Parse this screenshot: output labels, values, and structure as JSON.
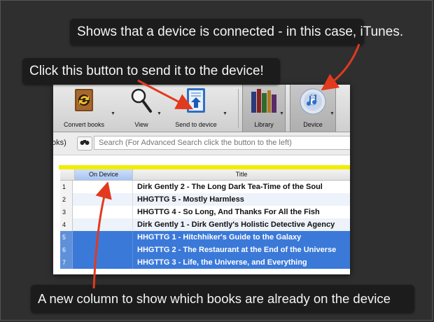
{
  "callouts": {
    "itunes": "Shows that a device is connected - in this case, iTunes.",
    "send": "Click this button to send it to the device!",
    "column": "A new column to show which books are already on the device"
  },
  "toolbar": {
    "convert_label": "Convert books",
    "view_label": "View",
    "send_label": "Send to device",
    "library_label": "Library",
    "device_label": "Device"
  },
  "search": {
    "left_text": "oks)",
    "binoculars_icon": "binoculars-icon",
    "placeholder": "Search (For Advanced Search click the button to the left)"
  },
  "table": {
    "columns": [
      "On Device",
      "Title"
    ],
    "rows": [
      {
        "num": "1",
        "title": "Dirk Gently 2 - The Long Dark Tea-Time of the Soul",
        "selected": false
      },
      {
        "num": "2",
        "title": "HHGTTG 5 - Mostly Harmless",
        "selected": false
      },
      {
        "num": "3",
        "title": "HHGTTG 4 - So Long, And Thanks For All the Fish",
        "selected": false
      },
      {
        "num": "4",
        "title": "Dirk Gently 1 - Dirk Gently's Holistic Detective Agency",
        "selected": false
      },
      {
        "num": "5",
        "title": "HHGTTG 1 - Hitchhiker's Guide to the Galaxy",
        "selected": true
      },
      {
        "num": "6",
        "title": "HHGTTG 2 - The Restaurant at the End of the Universe",
        "selected": true
      },
      {
        "num": "7",
        "title": "HHGTTG 3 - Life, the Universe, and Everything",
        "selected": true
      }
    ]
  },
  "colors": {
    "arrow": "#e23a1e",
    "selection": "#3b79d9",
    "highlight_bar": "#f1ed00"
  }
}
